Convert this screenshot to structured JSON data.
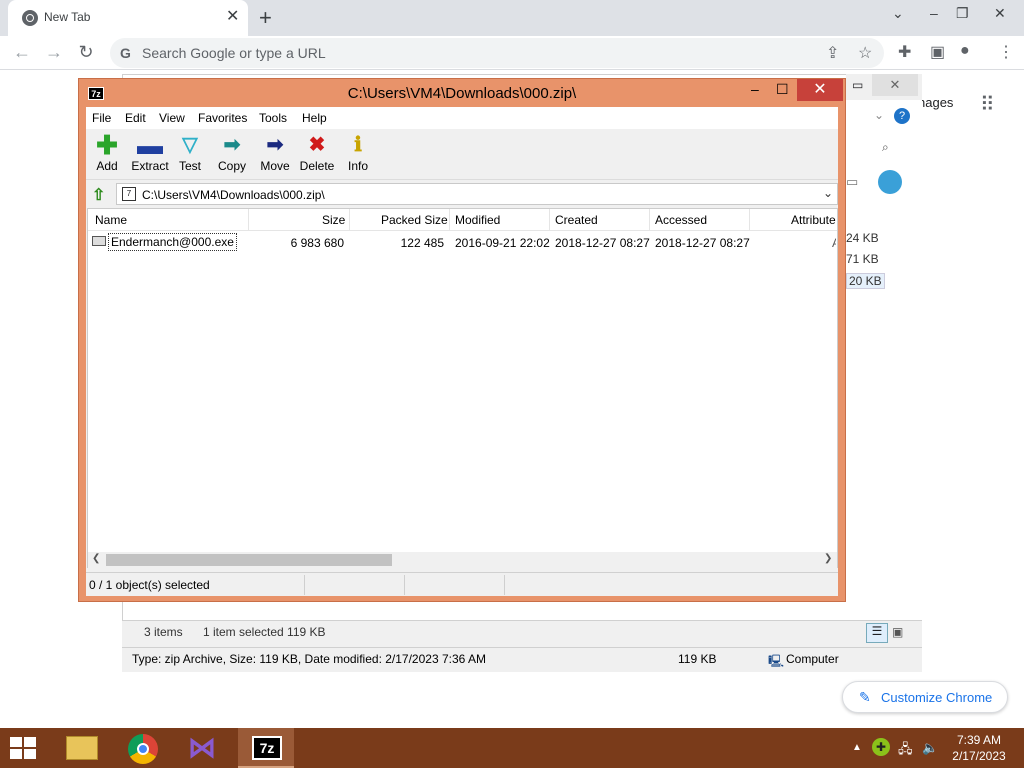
{
  "chrome": {
    "tab_title": "New Tab",
    "omnibox_placeholder": "Search Google or type a URL",
    "images_link": "nages",
    "customize_label": "Customize Chrome"
  },
  "background_explorer": {
    "sizes": [
      "24 KB",
      "71 KB",
      "20 KB"
    ],
    "status_items": "3 items",
    "status_selected": "1 item selected  119 KB",
    "details": "Type: zip Archive, Size: 119 KB, Date modified: 2/17/2023 7:36 AM",
    "details_size": "119 KB",
    "details_location": "Computer"
  },
  "sevenzip": {
    "title": "C:\\Users\\VM4\\Downloads\\000.zip\\",
    "app_icon": "7z",
    "menu": [
      "File",
      "Edit",
      "View",
      "Favorites",
      "Tools",
      "Help"
    ],
    "toolbar": [
      {
        "label": "Add",
        "icon": "plus-icon",
        "color": "#2aa52a"
      },
      {
        "label": "Extract",
        "icon": "minus-icon",
        "color": "#1f3fa0"
      },
      {
        "label": "Test",
        "icon": "check-icon",
        "color": "#2fb0c8"
      },
      {
        "label": "Copy",
        "icon": "copy-arrow-icon",
        "color": "#1b8a8a"
      },
      {
        "label": "Move",
        "icon": "move-arrow-icon",
        "color": "#1b2a80"
      },
      {
        "label": "Delete",
        "icon": "delete-x-icon",
        "color": "#d01a1a"
      },
      {
        "label": "Info",
        "icon": "info-icon",
        "color": "#c8a400"
      }
    ],
    "path": "C:\\Users\\VM4\\Downloads\\000.zip\\",
    "columns": [
      "Name",
      "Size",
      "Packed Size",
      "Modified",
      "Created",
      "Accessed",
      "Attribute"
    ],
    "rows": [
      {
        "name": "Endermanch@000.exe",
        "size": "6 983 680",
        "packed_size": "122 485",
        "modified": "2016-09-21 22:02",
        "created": "2018-12-27 08:27",
        "accessed": "2018-12-27 08:27",
        "attribute": "A"
      }
    ],
    "status": "0 / 1 object(s) selected"
  },
  "taskbar": {
    "time": "7:39 AM",
    "date": "2/17/2023",
    "apps": [
      "file-explorer",
      "chrome",
      "visual-studio",
      "7-zip"
    ],
    "active_app": "7-zip"
  },
  "colors": {
    "sevenzip_frame": "#e8936a",
    "close_button": "#c7413a",
    "taskbar": "#7a3b1a"
  }
}
